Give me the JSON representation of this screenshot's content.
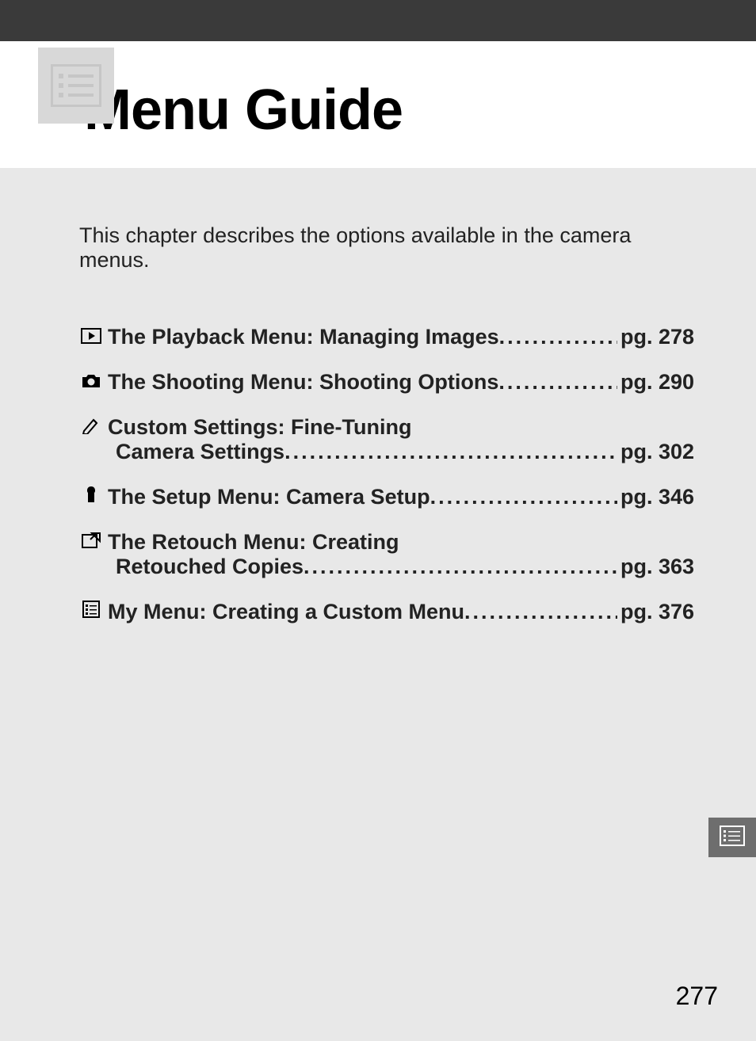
{
  "heading": {
    "title": "Menu Guide"
  },
  "intro": "This chapter describes the options available in the camera menus.",
  "toc": {
    "items": [
      {
        "icon": "playback-icon",
        "label": "The Playback Menu: Managing Images",
        "page": "pg. 278",
        "wrap": false
      },
      {
        "icon": "camera-icon",
        "label": "The Shooting Menu: Shooting Options",
        "page": "pg. 290",
        "wrap": false
      },
      {
        "icon": "pencil-icon",
        "label1": "Custom Settings: Fine-Tuning",
        "label2": "Camera Settings",
        "page": "pg. 302",
        "wrap": true
      },
      {
        "icon": "wrench-icon",
        "label": "The Setup Menu: Camera Setup",
        "page": "pg. 346",
        "wrap": false
      },
      {
        "icon": "retouch-icon",
        "label1": "The Retouch Menu: Creating",
        "label2": "Retouched Copies",
        "page": "pg. 363",
        "wrap": true
      },
      {
        "icon": "mymenu-icon",
        "label": "My Menu: Creating a Custom Menu",
        "page": "pg. 376",
        "wrap": false
      }
    ]
  },
  "page_number": "277"
}
